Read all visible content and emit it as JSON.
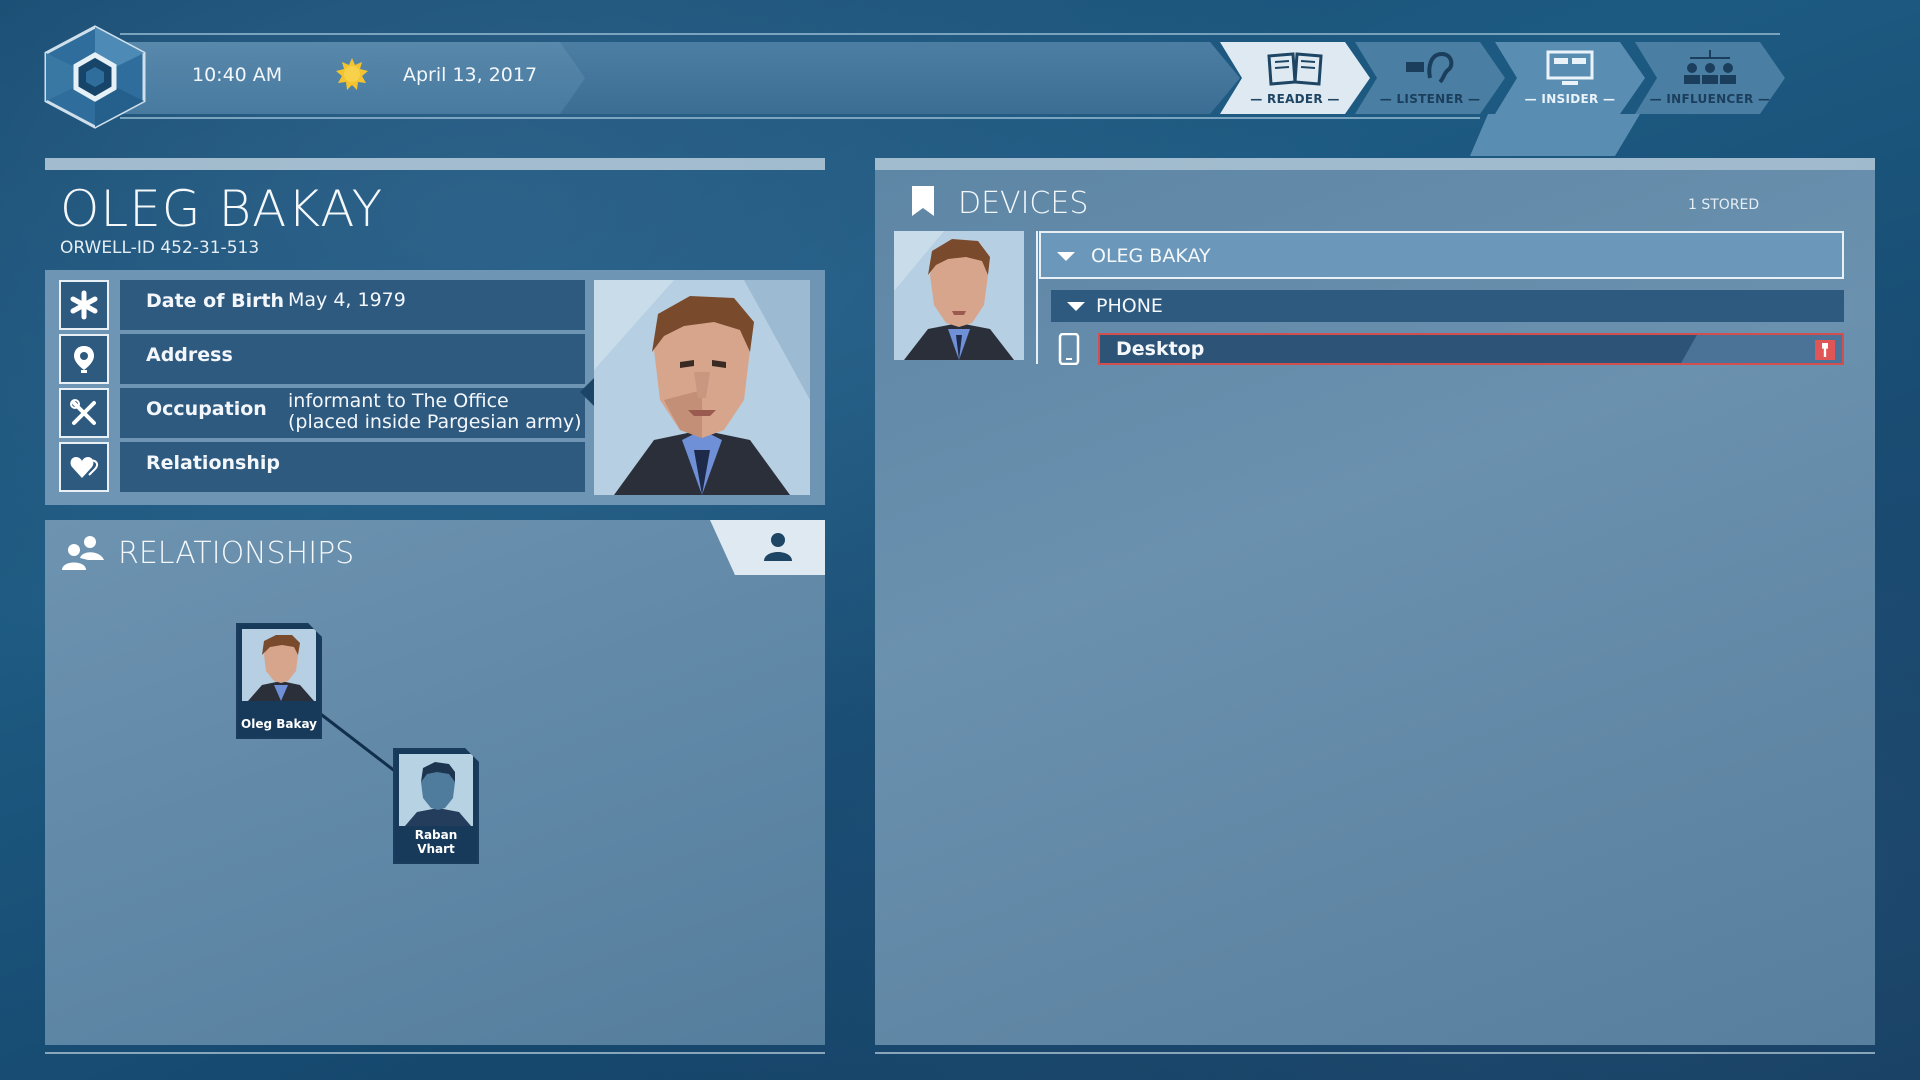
{
  "header": {
    "time": "10:40 AM",
    "date": "April 13, 2017",
    "weather_icon": "sun-icon",
    "tabs": [
      {
        "label": "— READER —",
        "icon": "book-icon",
        "active": false,
        "highlight": true
      },
      {
        "label": "— LISTENER —",
        "icon": "ear-icon",
        "active": false
      },
      {
        "label": "— INSIDER —",
        "icon": "monitor-icon",
        "active": true
      },
      {
        "label": "— INFLUENCER —",
        "icon": "org-chart-icon",
        "active": false
      }
    ]
  },
  "profile": {
    "name": "OLEG BAKAY",
    "orwell_id": "ORWELL-ID  452-31-513",
    "fields": [
      {
        "icon": "asterisk-icon",
        "label": "Date of Birth",
        "value": "May 4, 1979"
      },
      {
        "icon": "location-pin-icon",
        "label": "Address",
        "value": ""
      },
      {
        "icon": "tools-icon",
        "label": "Occupation",
        "value_line1": "informant to The Office",
        "value_line2": "(placed inside Pargesian army)"
      },
      {
        "icon": "heart-icon",
        "label": "Relationship",
        "value": ""
      }
    ]
  },
  "relationships": {
    "title": "RELATIONSHIPS",
    "nodes": [
      {
        "name": "Oleg Bakay"
      },
      {
        "name": "Raban Vhart"
      }
    ]
  },
  "devices": {
    "title": "DEVICES",
    "stored": "1 STORED",
    "owner": "OLEG BAKAY",
    "category": "PHONE",
    "items": [
      {
        "name": "Desktop",
        "status": "locked"
      }
    ]
  },
  "colors": {
    "background": "#1d5a82",
    "panel": "#6a91ae",
    "row": "#2e5a80",
    "alert": "#d24f4f"
  }
}
